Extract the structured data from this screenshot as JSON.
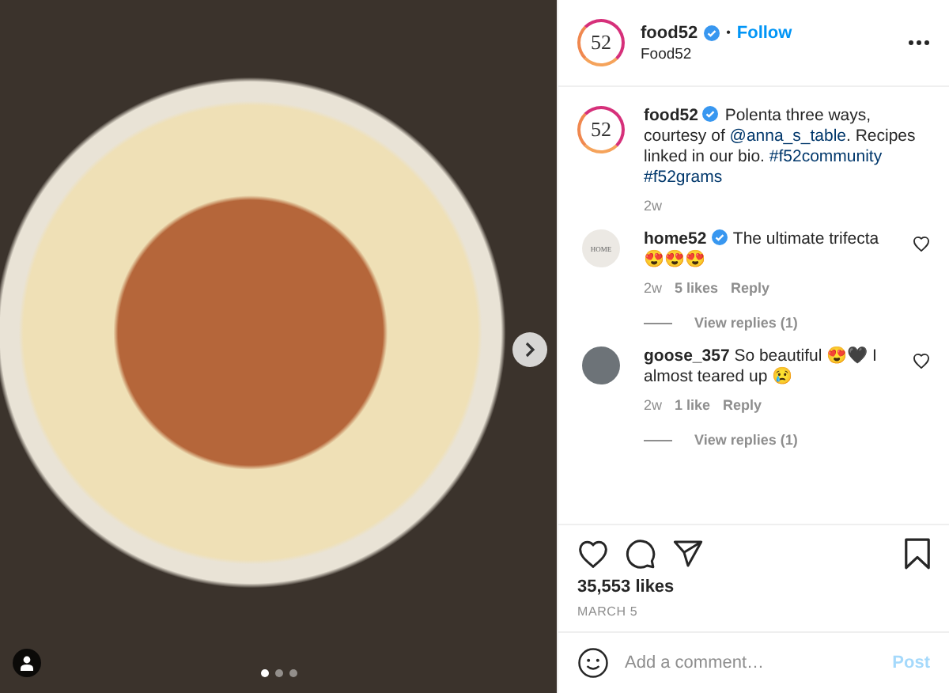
{
  "photo": {
    "slides": [
      {
        "selected": true
      },
      {
        "selected": false
      },
      {
        "selected": false
      }
    ]
  },
  "header": {
    "avatar_text": "52",
    "username": "food52",
    "verified": true,
    "separator": "•",
    "follow": "Follow",
    "subtitle": "Food52"
  },
  "caption": {
    "avatar_text": "52",
    "username": "food52",
    "verified": true,
    "text": "Polenta three ways, courtesy of ",
    "mention": "@anna_s_table",
    "text_after": ". Recipes linked in our bio.",
    "hashtags": [
      "#f52community",
      "#f52grams"
    ],
    "time": "2w"
  },
  "comments": [
    {
      "kind": "logo",
      "avatar_text": "HOME",
      "username": "home52",
      "verified": true,
      "text": "The ultimate trifecta 😍😍😍",
      "time": "2w",
      "likes": "5 likes",
      "reply": "Reply",
      "view_replies": "View replies (1)",
      "liked": false
    },
    {
      "kind": "photo",
      "username": "goose_357",
      "verified": false,
      "text": "So beautiful 😍🖤 I almost teared up 😢",
      "time": "2w",
      "likes": "1 like",
      "reply": "Reply",
      "view_replies": "View replies (1)",
      "liked": false
    }
  ],
  "likes": "35,553 likes",
  "date": "MARCH 5",
  "comment_box": {
    "placeholder": "Add a comment…",
    "post": "Post",
    "post_disabled": true
  }
}
